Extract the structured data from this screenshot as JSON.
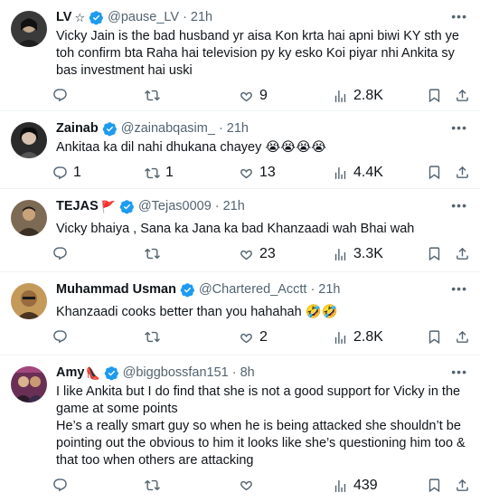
{
  "tweets": [
    {
      "display_name": "LV",
      "name_extra": "☆",
      "verified": true,
      "handle": "@pause_LV",
      "time": "21h",
      "text": "Vicky Jain is the bad husband yr aisa Kon krta hai apni biwi KY sth ye toh confirm bta Raha hai television py ky esko Koi piyar nhi Ankita sy bas investment hai uski",
      "replies": "",
      "retweets": "",
      "likes": "9",
      "views": "2.8K",
      "avatar_color": "#3a3a3a"
    },
    {
      "display_name": "Zainab",
      "name_extra": "",
      "verified": true,
      "handle": "@zainabqasim_",
      "time": "21h",
      "text": "Ankitaa ka dil nahi dhukana chayey 😭😭😭😭",
      "replies": "1",
      "retweets": "1",
      "likes": "13",
      "views": "4.4K",
      "avatar_color": "#2b2b2b"
    },
    {
      "display_name": "TEJAS",
      "name_extra": "🚩",
      "verified": true,
      "handle": "@Tejas0009",
      "time": "21h",
      "text": "Vicky bhaiya , Sana ka Jana ka bad Khanzaadi wah Bhai wah",
      "replies": "",
      "retweets": "",
      "likes": "23",
      "views": "3.3K",
      "avatar_color": "#6b5a48"
    },
    {
      "display_name": "Muhammad Usman",
      "name_extra": "",
      "verified": true,
      "handle": "@Chartered_Acctt",
      "time": "21h",
      "text": "Khanzaadi cooks better than you hahahah 🤣🤣",
      "replies": "",
      "retweets": "",
      "likes": "2",
      "views": "2.8K",
      "avatar_color": "#8a6a3c"
    },
    {
      "display_name": "Amy",
      "name_extra": "👠",
      "verified": true,
      "handle": "@biggbossfan151",
      "time": "8h",
      "text": "I like Ankita but I do find that she is not a good support for Vicky in the game at some points\nHe’s a really smart guy so when he is being attacked she shouldn’t be pointing out the obvious to him it looks like she’s questioning him too & that too when others are attacking",
      "replies": "",
      "retweets": "",
      "likes": "",
      "views": "439",
      "avatar_color": "#7a3f62"
    }
  ],
  "icons": {
    "reply": "reply-icon",
    "retweet": "retweet-icon",
    "like": "heart-icon",
    "views": "views-icon",
    "bookmark": "bookmark-icon",
    "share": "share-icon",
    "more": "more-icon",
    "verified": "verified-badge-icon"
  },
  "colors": {
    "verified": "#1d9bf0",
    "muted": "#536471",
    "divider": "#eff3f4"
  }
}
